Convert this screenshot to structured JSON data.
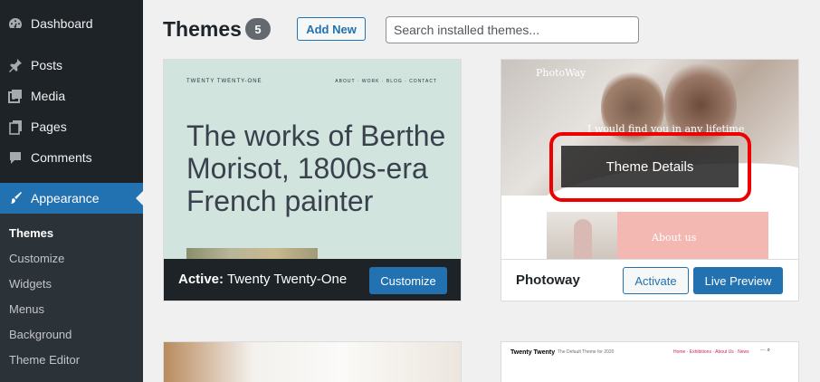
{
  "sidebar": {
    "items": [
      {
        "label": "Dashboard",
        "icon": "dashboard-icon"
      },
      {
        "label": "Posts",
        "icon": "pushpin-icon"
      },
      {
        "label": "Media",
        "icon": "media-icon"
      },
      {
        "label": "Pages",
        "icon": "pages-icon"
      },
      {
        "label": "Comments",
        "icon": "comment-icon"
      },
      {
        "label": "Appearance",
        "icon": "paintbrush-icon"
      }
    ],
    "submenu": [
      "Themes",
      "Customize",
      "Widgets",
      "Menus",
      "Background",
      "Theme Editor"
    ]
  },
  "header": {
    "title": "Themes",
    "count": "5",
    "add_new": "Add New",
    "search_placeholder": "Search installed themes..."
  },
  "themes": {
    "active": {
      "site_title": "TWENTY TWENTY-ONE",
      "nav": "ABOUT · WORK · BLOG · CONTACT",
      "headline": "The works of Berthe Morisot, 1800s-era French painter",
      "active_prefix": "Active:",
      "name": "Twenty Twenty-One",
      "customize": "Customize"
    },
    "photoway": {
      "logo": "PhotoWay",
      "tagline": "I would find you in any lifetime",
      "about": "About us",
      "details": "Theme Details",
      "name": "Photoway",
      "activate": "Activate",
      "live_preview": "Live Preview"
    },
    "twentytwenty": {
      "title": "Twenty Twenty",
      "tagline": "The Default Theme for 2020",
      "nav": "Home · Exhibitions · About Us · News",
      "icons": "··· ⌕"
    }
  },
  "colors": {
    "sidebar_bg": "#1d2327",
    "accent": "#2271b1",
    "highlight": "#ee0000"
  }
}
